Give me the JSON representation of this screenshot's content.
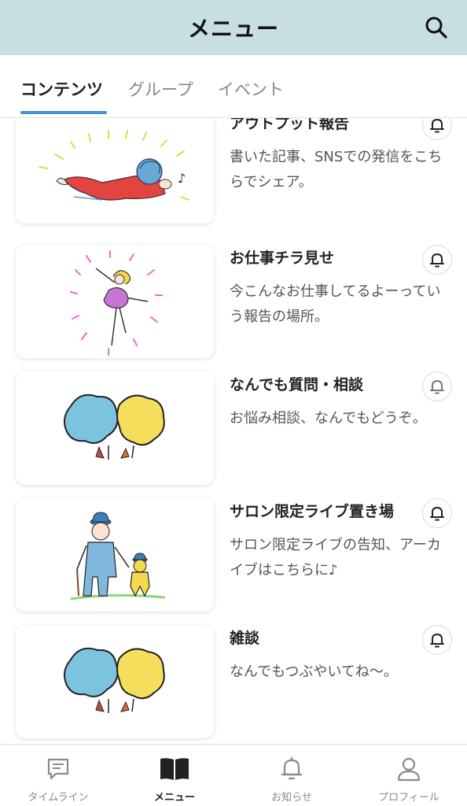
{
  "header": {
    "title": "メニュー"
  },
  "tabs": [
    {
      "label": "コンテンツ",
      "active": true
    },
    {
      "label": "グループ",
      "active": false
    },
    {
      "label": "イベント",
      "active": false
    }
  ],
  "items": [
    {
      "title": "アウトプット報告",
      "description": "書いた記事、SNSでの発信をこちらでシェア。",
      "illustration": "swimming-person"
    },
    {
      "title": "お仕事チラ見せ",
      "description": "今こんなお仕事してるよーっていう報告の場所。",
      "illustration": "dancer"
    },
    {
      "title": "なんでも質問・相談",
      "description": "お悩み相談、なんでもどうぞ。",
      "illustration": "speech-bubbles"
    },
    {
      "title": "サロン限定ライブ置き場",
      "description": "サロン限定ライブの告知、アーカイブはこちらに♪",
      "illustration": "man-and-child"
    },
    {
      "title": "雑談",
      "description": "なんでもつぶやいてね〜。",
      "illustration": "speech-bubbles"
    }
  ],
  "bottom_nav": [
    {
      "label": "タイムライン",
      "icon": "chat-icon",
      "active": false
    },
    {
      "label": "メニュー",
      "icon": "book-icon",
      "active": true
    },
    {
      "label": "お知らせ",
      "icon": "bell-icon",
      "active": false
    },
    {
      "label": "プロフィール",
      "icon": "person-icon",
      "active": false
    }
  ],
  "colors": {
    "header_bg": "#c8dfe2",
    "tab_accent": "#4a8fd8"
  }
}
